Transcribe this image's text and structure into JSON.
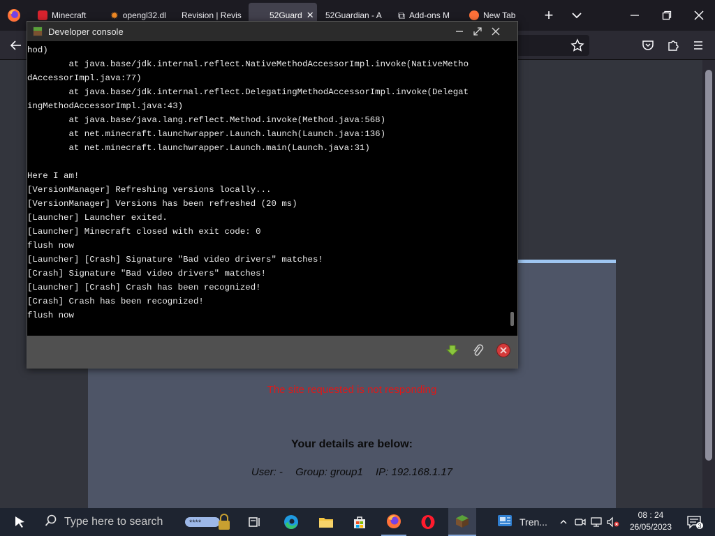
{
  "browser": {
    "tabs": [
      {
        "title": "Minecraft",
        "active": false
      },
      {
        "title": "opengl32.dl",
        "active": false
      },
      {
        "title": "Revision | Revis",
        "active": false
      },
      {
        "title": "52Guard",
        "active": true
      },
      {
        "title": "52Guardian - A",
        "active": false
      },
      {
        "title": "Add-ons M",
        "active": false
      },
      {
        "title": "New Tab",
        "active": false
      }
    ]
  },
  "console": {
    "title": "Developer console",
    "lines": [
      "hod)",
      "        at java.base/jdk.internal.reflect.NativeMethodAccessorImpl.invoke(NativeMetho",
      "dAccessorImpl.java:77)",
      "        at java.base/jdk.internal.reflect.DelegatingMethodAccessorImpl.invoke(Delegat",
      "ingMethodAccessorImpl.java:43)",
      "        at java.base/java.lang.reflect.Method.invoke(Method.java:568)",
      "        at net.minecraft.launchwrapper.Launch.launch(Launch.java:136)",
      "        at net.minecraft.launchwrapper.Launch.main(Launch.java:31)",
      "",
      "Here I am!",
      "[VersionManager] Refreshing versions locally...",
      "[VersionManager] Versions has been refreshed (20 ms)",
      "[Launcher] Launcher exited.",
      "[Launcher] Minecraft closed with exit code: 0",
      "flush now",
      "[Launcher] [Crash] Signature \"Bad video drivers\" matches!",
      "[Crash] Signature \"Bad video drivers\" matches!",
      "[Launcher] [Crash] Crash has been recognized!",
      "[Crash] Crash has been recognized!",
      "flush now"
    ]
  },
  "page": {
    "error_text": "The site requested is not responding",
    "details_heading": "Your details are below:",
    "user": "User: -",
    "group": "Group: group1",
    "ip": "IP: 192.168.1.17"
  },
  "taskbar": {
    "search_placeholder": "Type here to search",
    "news_label": "Tren...",
    "time": "08 : 24",
    "date": "26/05/2023",
    "notification_count": "3"
  },
  "colors": {
    "error": "#e01818",
    "panel": "#4e5567",
    "console_bg": "#000000"
  }
}
